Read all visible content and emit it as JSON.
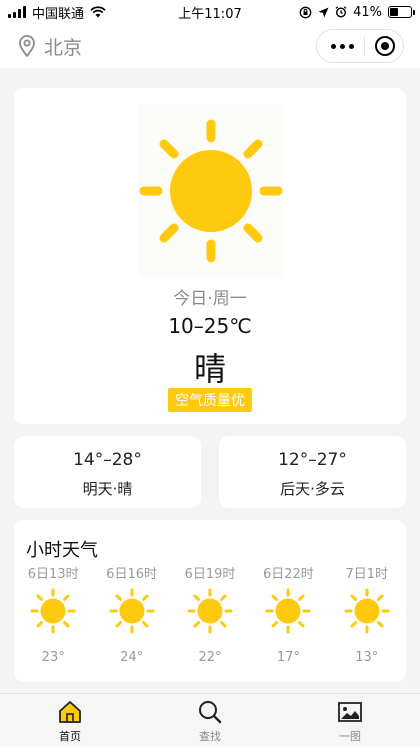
{
  "status_bar": {
    "carrier": "中国联通",
    "time": "上午11:07",
    "battery": "41%",
    "battery_level": 0.41
  },
  "nav": {
    "city": "北京"
  },
  "today": {
    "label": "今日·周一",
    "temp_range": "10–25℃",
    "weather": "晴",
    "air_quality": "空气质量优",
    "icon": "sun-icon"
  },
  "forecast": [
    {
      "temp": "14°–28°",
      "label": "明天·晴"
    },
    {
      "temp": "12°–27°",
      "label": "后天·多云"
    }
  ],
  "hourly": {
    "title": "小时天气",
    "items": [
      {
        "time": "6日13时",
        "temp": "23°",
        "icon": "sun-icon"
      },
      {
        "time": "6日16时",
        "temp": "24°",
        "icon": "sun-icon"
      },
      {
        "time": "6日19时",
        "temp": "22°",
        "icon": "sun-icon"
      },
      {
        "time": "6日22时",
        "temp": "17°",
        "icon": "sun-icon"
      },
      {
        "time": "7日1时",
        "temp": "13°",
        "icon": "sun-icon"
      }
    ]
  },
  "tabs": [
    {
      "label": "首页",
      "icon": "home-icon",
      "active": true
    },
    {
      "label": "查找",
      "icon": "search-icon",
      "active": false
    },
    {
      "label": "一图",
      "icon": "image-icon",
      "active": false
    }
  ],
  "colors": {
    "accent": "#ffc90e",
    "text_muted": "#8a8a8a"
  }
}
